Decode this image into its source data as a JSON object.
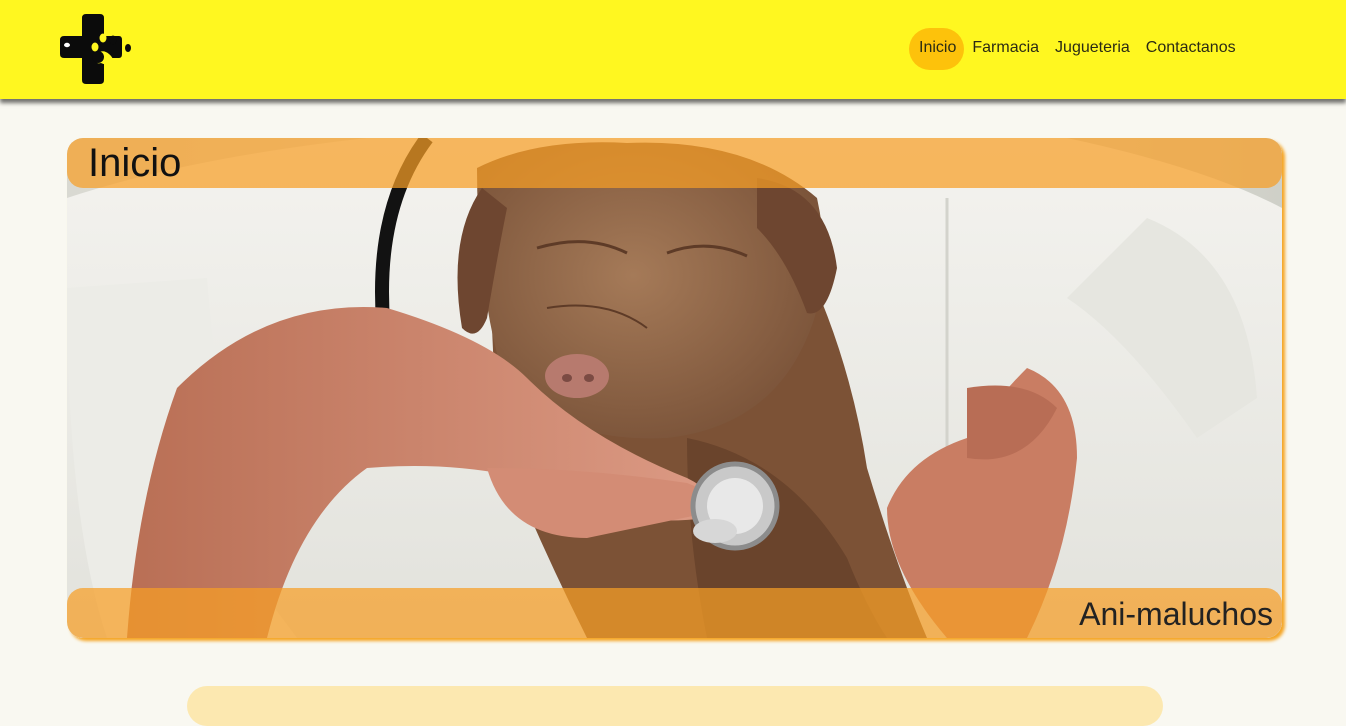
{
  "header": {
    "logo_icon": "paw-cross-logo-icon",
    "nav": [
      {
        "label": "Inicio",
        "active": true
      },
      {
        "label": "Farmacia",
        "active": false
      },
      {
        "label": "Jugueteria",
        "active": false
      },
      {
        "label": "Contactanos",
        "active": false
      }
    ]
  },
  "hero": {
    "title": "Inicio",
    "caption": "Ani-maluchos",
    "image": "veterinarian-with-puppy-photo"
  },
  "colors": {
    "header_bg": "#fff720",
    "nav_active": "#fdc20b",
    "overlay": "#f79e26",
    "page_bg": "#f9f8f1"
  }
}
